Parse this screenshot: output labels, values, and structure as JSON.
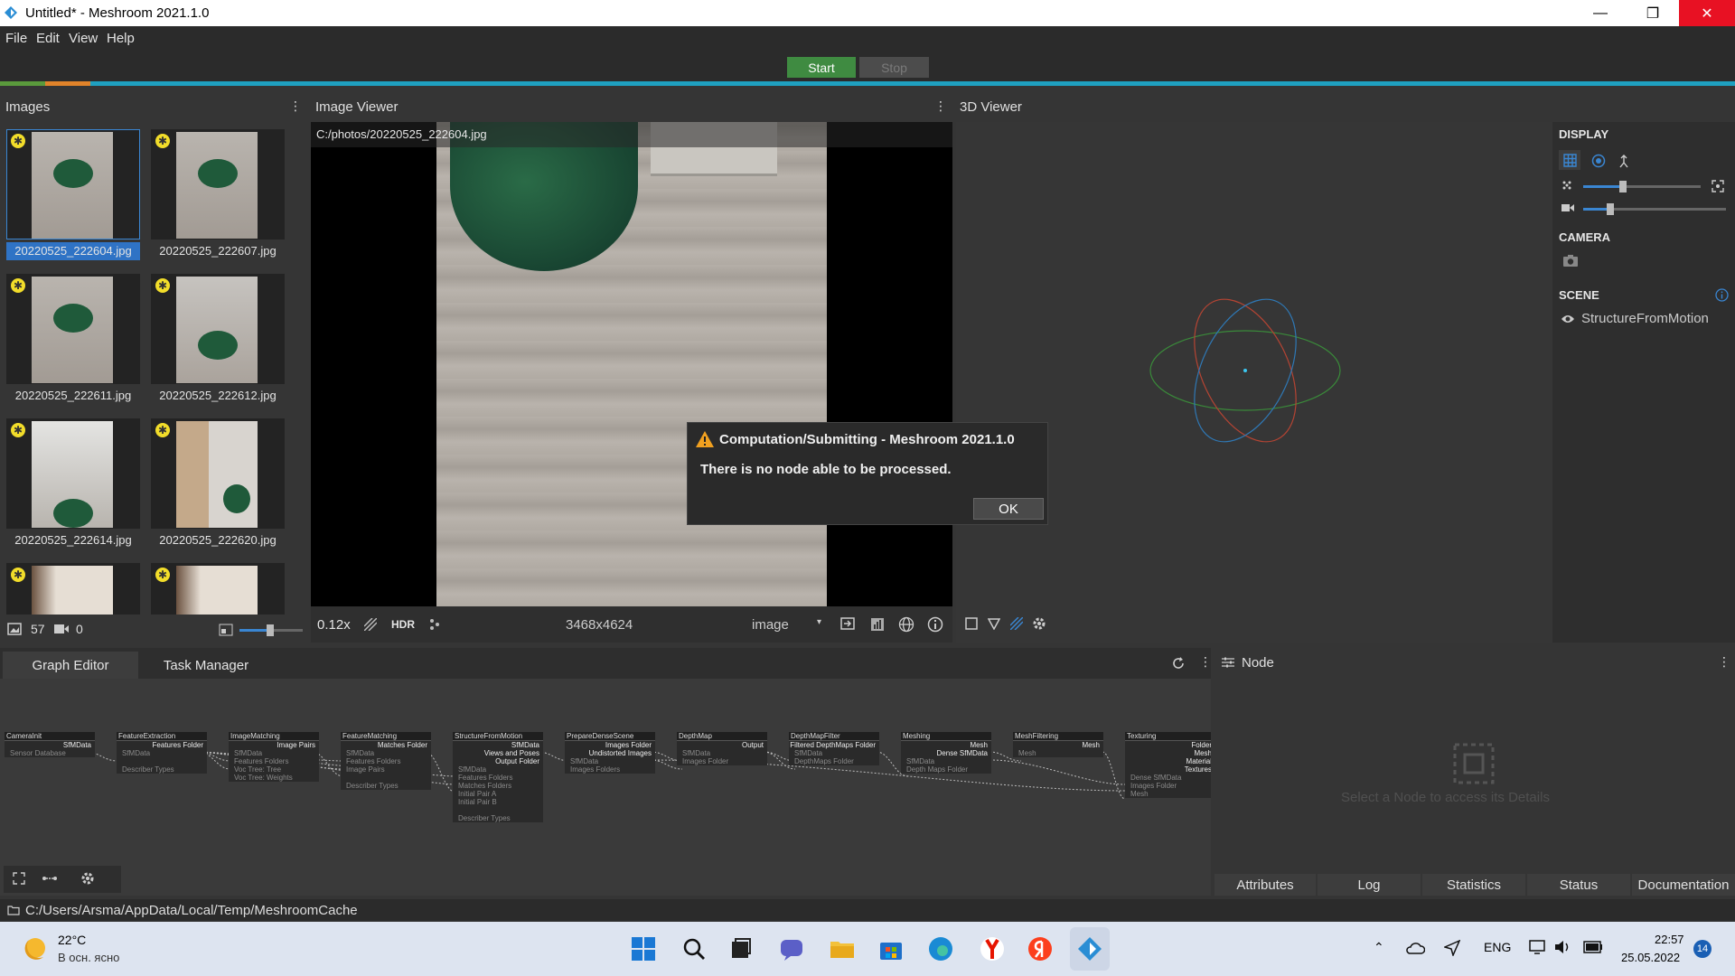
{
  "window": {
    "title": "Untitled* - Meshroom 2021.1.0",
    "minimize": "—",
    "restore": "❐",
    "close": "✕"
  },
  "menu": {
    "file": "File",
    "edit": "Edit",
    "view": "View",
    "help": "Help"
  },
  "toolbar": {
    "start": "Start",
    "stop": "Stop"
  },
  "colors": {
    "accent": "#3a86d2",
    "start": "#3f8b41",
    "progress": "#1fa0c0"
  },
  "images_panel": {
    "title": "Images",
    "thumbs": [
      {
        "name": "20220525_222604.jpg",
        "selected": true
      },
      {
        "name": "20220525_222607.jpg"
      },
      {
        "name": "20220525_222611.jpg"
      },
      {
        "name": "20220525_222612.jpg"
      },
      {
        "name": "20220525_222614.jpg"
      },
      {
        "name": "20220525_222620.jpg"
      },
      {
        "name": ""
      },
      {
        "name": ""
      }
    ],
    "count": "57",
    "video_count": "0"
  },
  "image_viewer": {
    "title": "Image Viewer",
    "path": "C:/photos/20220525_222604.jpg",
    "zoom": "0.12x",
    "hdr": "HDR",
    "resolution": "3468x4624",
    "mode": "image"
  },
  "viewer3d": {
    "title": "3D Viewer",
    "display": "DISPLAY",
    "camera": "CAMERA",
    "scene": "SCENE",
    "scene_item": "StructureFromMotion"
  },
  "dialog": {
    "title": "Computation/Submitting - Meshroom 2021.1.0",
    "message": "There is no node able to be processed.",
    "ok": "OK"
  },
  "graph_tabs": {
    "graph": "Graph Editor",
    "tasks": "Task Manager"
  },
  "nodes": [
    {
      "title": "CameraInit",
      "outs": [
        "SfMData"
      ],
      "ins": [
        "Sensor Database"
      ]
    },
    {
      "title": "FeatureExtraction",
      "outs": [
        "Features Folder"
      ],
      "ins": [
        "SfMData",
        "",
        "Describer Types"
      ]
    },
    {
      "title": "ImageMatching",
      "outs": [
        "Image Pairs"
      ],
      "ins": [
        "SfMData",
        "Features Folders",
        "Voc Tree: Tree",
        "Voc Tree: Weights"
      ]
    },
    {
      "title": "FeatureMatching",
      "outs": [
        "Matches Folder"
      ],
      "ins": [
        "SfMData",
        "Features Folders",
        "Image Pairs",
        "",
        "Describer Types"
      ]
    },
    {
      "title": "StructureFromMotion",
      "outs": [
        "SfMData",
        "Views and Poses",
        "Output Folder"
      ],
      "ins": [
        "SfMData",
        "Features Folders",
        "Matches Folders",
        "Initial Pair A",
        "Initial Pair B",
        "",
        "Describer Types"
      ]
    },
    {
      "title": "PrepareDenseScene",
      "outs": [
        "Images Folder",
        "Undistorted Images"
      ],
      "ins": [
        "SfMData",
        "Images Folders"
      ]
    },
    {
      "title": "DepthMap",
      "outs": [
        "Output"
      ],
      "ins": [
        "SfMData",
        "Images Folder"
      ]
    },
    {
      "title": "DepthMapFilter",
      "outs": [
        "Filtered DepthMaps Folder"
      ],
      "ins": [
        "SfMData",
        "DepthMaps Folder"
      ]
    },
    {
      "title": "Meshing",
      "outs": [
        "Mesh",
        "Dense SfMData"
      ],
      "ins": [
        "SfMData",
        "Depth Maps Folder"
      ]
    },
    {
      "title": "MeshFiltering",
      "outs": [
        "Mesh"
      ],
      "ins": [
        "Mesh"
      ]
    },
    {
      "title": "Texturing",
      "outs": [
        "Folder",
        "Mesh",
        "Material",
        "Textures"
      ],
      "ins": [
        "Dense SfMData",
        "Images Folder",
        "Mesh"
      ]
    }
  ],
  "node_panel": {
    "title": "Node",
    "placeholder": "Select a Node to access its Details",
    "tabs": [
      "Attributes",
      "Log",
      "Statistics",
      "Status",
      "Documentation"
    ]
  },
  "statusbar": {
    "path": "C:/Users/Arsma/AppData/Local/Temp/MeshroomCache"
  },
  "taskbar": {
    "weather_temp": "22°C",
    "weather_desc": "В осн. ясно",
    "lang": "ENG",
    "time": "22:57",
    "date": "25.05.2022",
    "notifications": "14"
  }
}
